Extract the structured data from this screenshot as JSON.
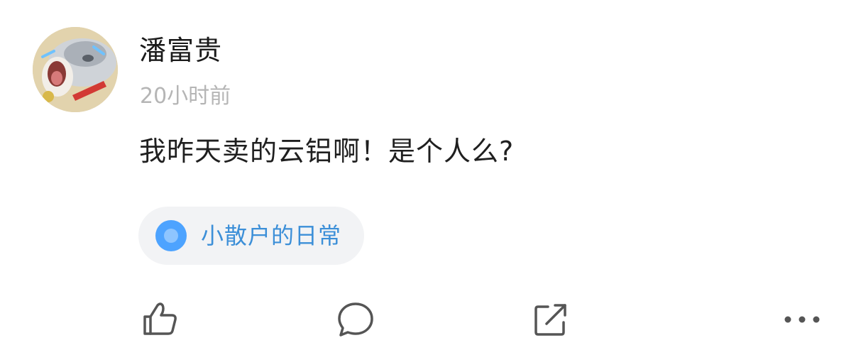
{
  "post": {
    "author": "潘富贵",
    "time": "20小时前",
    "content": "我昨天卖的云铝啊！是个人么?",
    "topic": {
      "label": "小散户的日常",
      "icon": "topic-circle-icon",
      "color": "#4da3ff"
    }
  },
  "actions": {
    "like_icon": "thumbs-up-icon",
    "comment_icon": "comment-bubble-icon",
    "share_icon": "share-icon",
    "more_icon": "more-dots-icon",
    "icon_color": "#555555"
  }
}
